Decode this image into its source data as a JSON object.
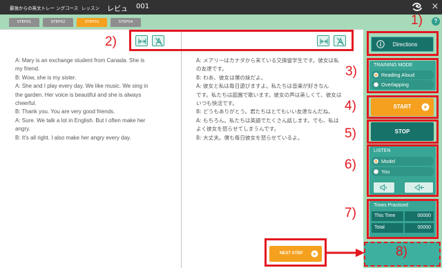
{
  "header": {
    "course": "最強からの英文トレー ングコース",
    "lesson": "レッスン",
    "review": "レビュ",
    "number": "001",
    "logo_icon": "swirl-logo-icon",
    "close": "×"
  },
  "tabs": [
    {
      "label": "STEP01",
      "active": false
    },
    {
      "label": "STEP02",
      "active": false
    },
    {
      "label": "STEP03",
      "active": true
    },
    {
      "label": "STEP04",
      "active": false
    }
  ],
  "help": "?",
  "toolbar": {
    "left_icons": [
      "expand-icon",
      "hide-text-icon"
    ],
    "right_icons": [
      "expand-icon",
      "hide-text-icon"
    ]
  },
  "english_lines": [
    "A: Mary is an exchange student from Canada. She is",
    "my friend.",
    "B: Wow, she is my sister.",
    "A: She and I play every day. We like music. We sing in",
    "the garden. Her voice is beautiful and she is always",
    "cheerful.",
    "B: Thank you. You are very good friends.",
    "A: Sure. We talk a lot in English. But I often make her",
    "angry.",
    "B: It's all right. I also make her angry every day."
  ],
  "japanese_lines": [
    "A: メアリーはカナダから来ている交換留学生です。彼女は私",
    "の友達です。",
    "B: わあ、彼女は僕の妹だよ。",
    "A: 彼女と私は毎日遊びますよ。私たちは音楽が好きなん",
    "です。私たちは庭園で歌います。彼女の声は美しくて、彼女は",
    "いつも快活です。",
    "B: どうもありがとう。君たちはとてもいい友達なんだね。",
    "A: もちろん。私たちは英語でたくさん話します。でも、私は",
    "よく彼女を怒らせてしまうんです。",
    "B: 大丈夫。僕も毎日彼女を怒らせているよ。"
  ],
  "sidebar": {
    "directions": {
      "label": "Directions",
      "icon": "info-icon"
    },
    "training_mode": {
      "title": "TRAINING MODE",
      "options": [
        {
          "label": "Reading Aloud",
          "selected": true
        },
        {
          "label": "Overlapping",
          "selected": false
        }
      ]
    },
    "start": {
      "label": "START",
      "icon": "arrow-circle-icon"
    },
    "stop": {
      "label": "STOP"
    },
    "listen": {
      "title": "LISTEN",
      "options": [
        {
          "label": "Model",
          "selected": true
        },
        {
          "label": "You",
          "selected": false
        }
      ],
      "buttons": [
        "speaker-icon",
        "playback-icon"
      ]
    },
    "times": {
      "title": "Times Practiced",
      "rows": [
        {
          "label": "This Time",
          "value": "00000"
        },
        {
          "label": "Total",
          "value": "00000"
        }
      ]
    }
  },
  "next_step": {
    "label": "NEXT STEP",
    "icon": "arrow-circle-icon"
  },
  "annotations": [
    "1)",
    "2)",
    "3)",
    "4)",
    "5)",
    "6)",
    "7)",
    "8)"
  ],
  "colors": {
    "orange": "#f5a01e",
    "teal-dark": "#17726a",
    "teal": "#38a595",
    "green-bg": "#a7dab8",
    "red": "#e2171f",
    "topbar": "#323232",
    "tab": "#8e8e8e",
    "slot": "#3db09f"
  }
}
